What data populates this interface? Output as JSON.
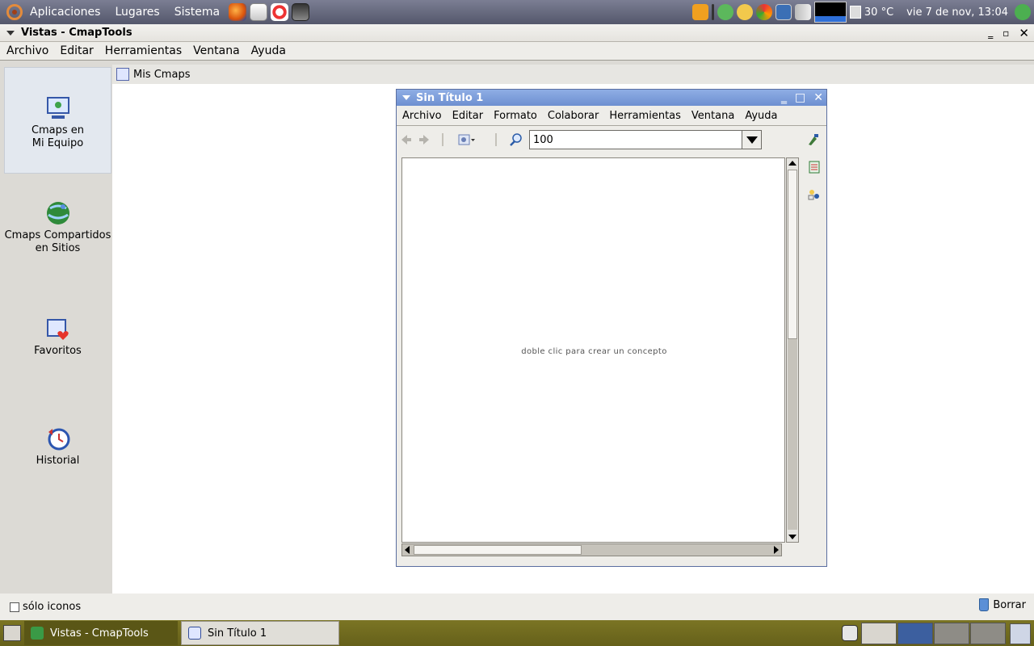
{
  "top_panel": {
    "menus": [
      "Aplicaciones",
      "Lugares",
      "Sistema"
    ],
    "temperature": "30 °C",
    "clock": "vie  7 de nov, 13:04"
  },
  "main_window": {
    "title": "Vistas - CmapTools",
    "menu": [
      "Archivo",
      "Editar",
      "Herramientas",
      "Ventana",
      "Ayuda"
    ]
  },
  "views": [
    {
      "label_line1": "Cmaps en",
      "label_line2": "Mi Equipo"
    },
    {
      "label_line1": "Cmaps Compartidos",
      "label_line2": "en Sitios"
    },
    {
      "label_line1": "Favoritos",
      "label_line2": ""
    },
    {
      "label_line1": "Historial",
      "label_line2": ""
    }
  ],
  "content": {
    "tab_label": "Mis Cmaps"
  },
  "cmap_window": {
    "title": "Sin Título 1",
    "menu": [
      "Archivo",
      "Editar",
      "Formato",
      "Colaborar",
      "Herramientas",
      "Ventana",
      "Ayuda"
    ],
    "zoom_value": "100",
    "canvas_hint": "doble clic para crear un concepto"
  },
  "bottom": {
    "only_icons_label": "sólo iconos",
    "delete_label": "Borrar"
  },
  "taskbar": {
    "tasks": [
      "Vistas - CmapTools",
      "Sin Título 1"
    ]
  },
  "colors": {
    "panel": "#54576b",
    "cmap_titlebar": "#6d8fd0",
    "taskbar": "#6f6a1c"
  }
}
